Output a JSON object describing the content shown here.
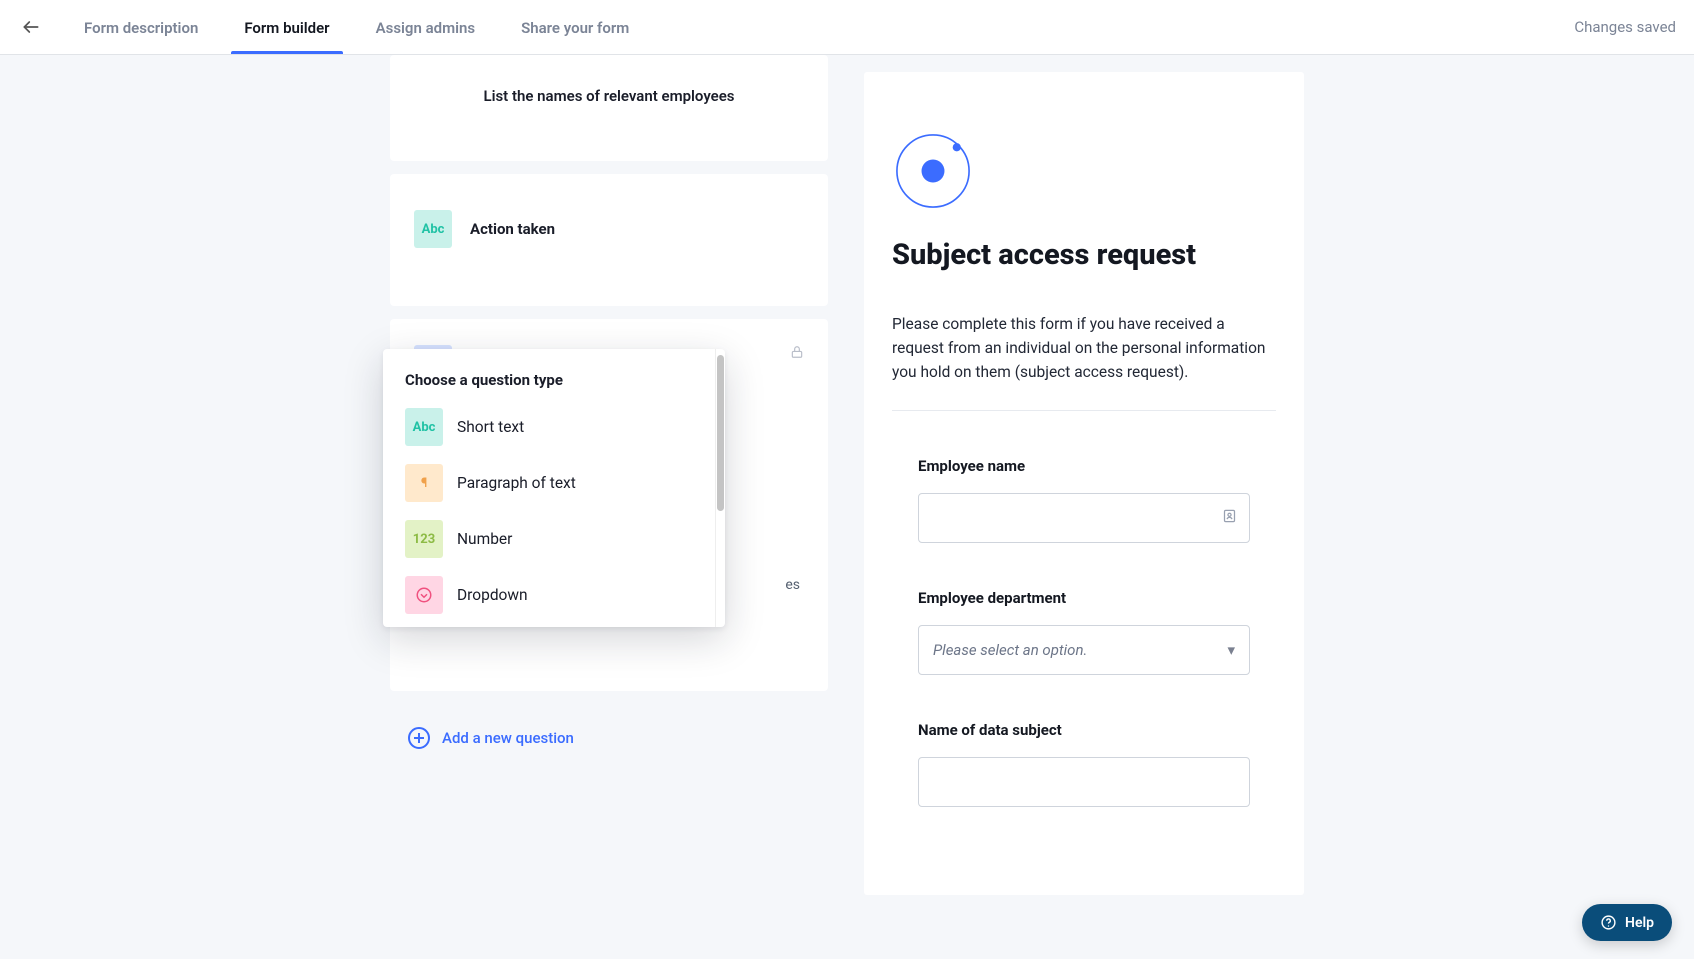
{
  "header": {
    "tabs": [
      {
        "label": "Form description"
      },
      {
        "label": "Form builder"
      },
      {
        "label": "Assign admins"
      },
      {
        "label": "Share your form"
      }
    ],
    "active_tab_index": 1,
    "status": "Changes saved"
  },
  "builder": {
    "cards": [
      {
        "title": "List the names of relevant employees"
      },
      {
        "badge": "Abc",
        "title": "Action taken"
      }
    ],
    "peek_fragment": "es",
    "popover": {
      "title": "Choose a question type",
      "options": [
        {
          "badge": "Abc",
          "label": "Short text"
        },
        {
          "badge": "¶",
          "label": "Paragraph of text"
        },
        {
          "badge": "123",
          "label": "Number"
        },
        {
          "badge": "⊙",
          "label": "Dropdown"
        }
      ]
    },
    "add_new_label": "Add a new question"
  },
  "preview": {
    "title": "Subject access request",
    "description": "Please complete this form if you have received a request from an individual on the personal information you hold on them (subject access request).",
    "fields": [
      {
        "label": "Employee name",
        "type": "text"
      },
      {
        "label": "Employee department",
        "type": "select",
        "placeholder": "Please select an option."
      },
      {
        "label": "Name of data subject",
        "type": "text"
      }
    ]
  },
  "help_label": "Help"
}
